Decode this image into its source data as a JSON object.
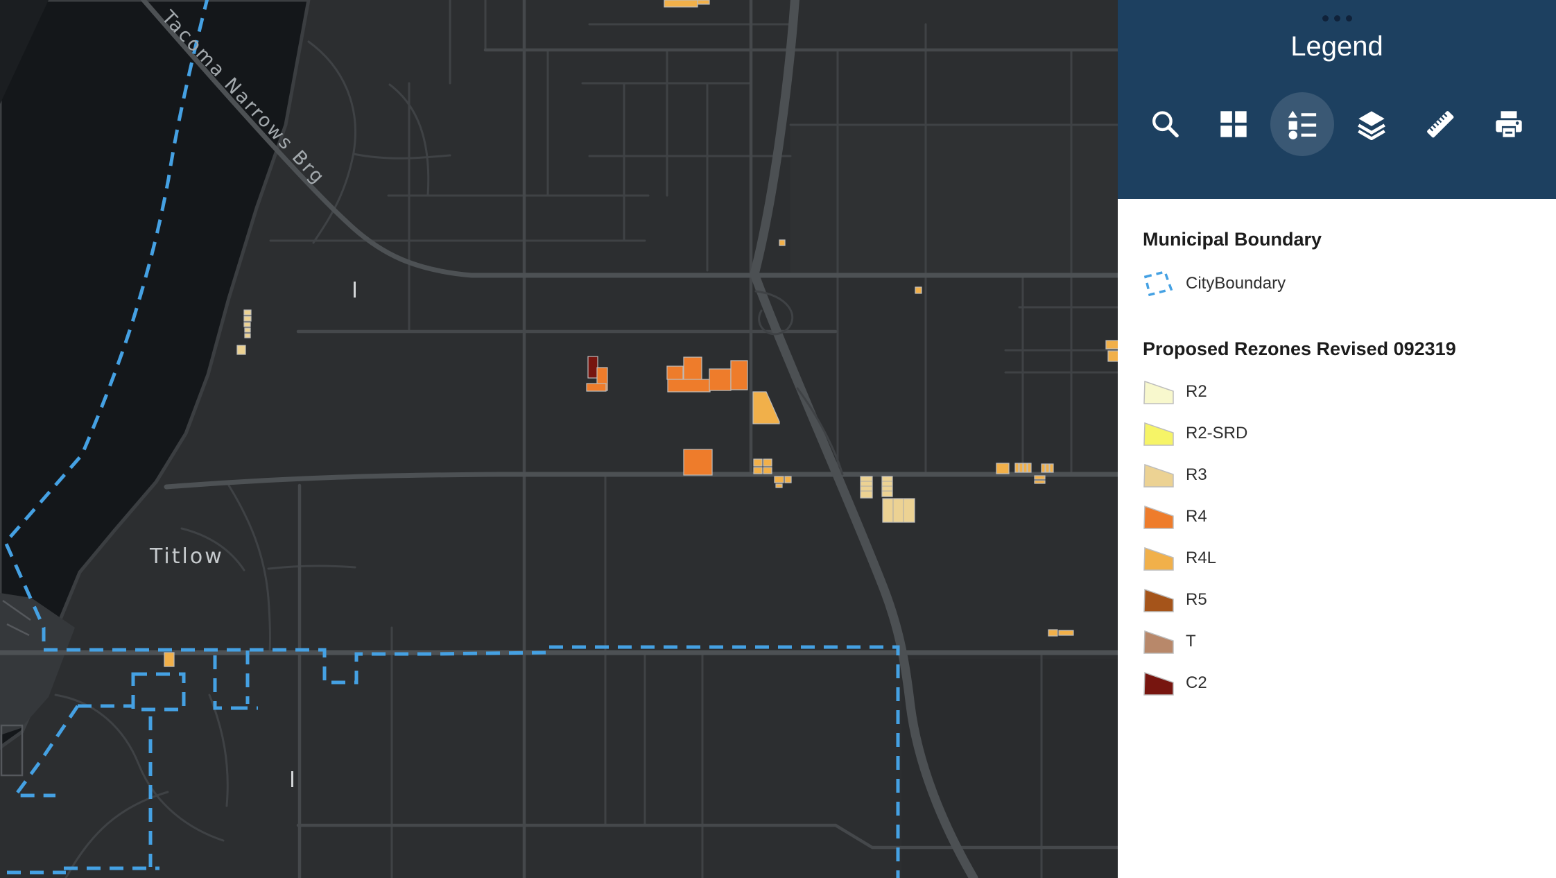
{
  "panel": {
    "title": "Legend",
    "toolbar": [
      {
        "name": "search",
        "icon": "search-icon",
        "active": false
      },
      {
        "name": "basemap",
        "icon": "basemap-grid-icon",
        "active": false
      },
      {
        "name": "legend",
        "icon": "legend-list-icon",
        "active": true
      },
      {
        "name": "layers",
        "icon": "layers-icon",
        "active": false
      },
      {
        "name": "measure",
        "icon": "ruler-icon",
        "active": false
      },
      {
        "name": "print",
        "icon": "printer-icon",
        "active": false
      }
    ],
    "sections": [
      {
        "heading": "Municipal Boundary",
        "items": [
          {
            "label": "CityBoundary",
            "zone": "CityBoundary"
          }
        ]
      },
      {
        "heading": "Proposed Rezones Revised 092319",
        "items": [
          {
            "label": "R2",
            "zone": "R2"
          },
          {
            "label": "R2-SRD",
            "zone": "R2-SRD"
          },
          {
            "label": "R3",
            "zone": "R3"
          },
          {
            "label": "R4",
            "zone": "R4"
          },
          {
            "label": "R4L",
            "zone": "R4L"
          },
          {
            "label": "R5",
            "zone": "R5"
          },
          {
            "label": "T",
            "zone": "T"
          },
          {
            "label": "C2",
            "zone": "C2"
          }
        ]
      }
    ]
  },
  "zones": {
    "CityBoundary": "#45A1E3",
    "R2": "#F8F8CD",
    "R2-SRD": "#F6F467",
    "R3": "#ECD293",
    "R4": "#EE7C2B",
    "R4L": "#F1B04A",
    "R5": "#A5541A",
    "T": "#B8886A",
    "C2": "#77150F"
  },
  "map": {
    "labels": [
      {
        "text": "Tacoma Narrows Brg"
      },
      {
        "text": "Titlow"
      }
    ],
    "colors": {
      "header": "#1d4060",
      "water": "#14171a",
      "land": "#2c2e30",
      "road": "#3f4245",
      "road_major": "#4d5154",
      "map_label": "#a3a9ad"
    }
  }
}
